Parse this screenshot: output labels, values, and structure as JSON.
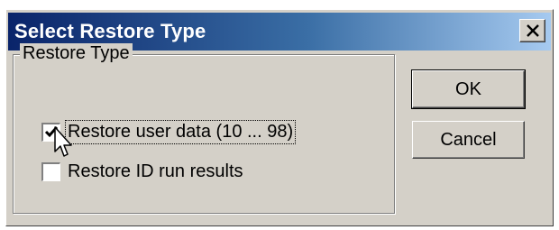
{
  "window": {
    "title": "Select Restore Type",
    "close_glyph": "×"
  },
  "group": {
    "legend": "Restore Type",
    "options": [
      {
        "label": "Restore user data (10 ... 98)",
        "checked": true,
        "focused": true
      },
      {
        "label": "Restore ID run results",
        "checked": false,
        "focused": false
      }
    ]
  },
  "buttons": {
    "ok_label": "OK",
    "cancel_label": "Cancel"
  },
  "colors": {
    "title_gradient_start": "#0a246a",
    "title_gradient_end": "#a6caf0",
    "face": "#d4d0c8"
  },
  "icons": {
    "close": "close-icon",
    "check": "check-icon",
    "cursor": "arrow-cursor-icon"
  }
}
